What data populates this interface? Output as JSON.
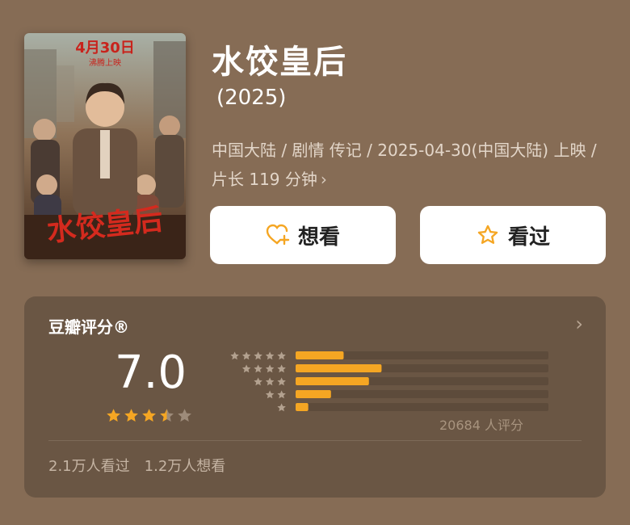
{
  "movie": {
    "title": "水饺皇后",
    "year": "(2025)",
    "meta": "中国大陆 / 剧情 传记 / 2025-04-30(中国大陆) 上映 / 片长 119 分钟",
    "poster": {
      "date": "4月30日",
      "tagline": "沸腾上映",
      "calligraphy": "水饺皇后"
    }
  },
  "actions": {
    "want_label": "想看",
    "seen_label": "看过"
  },
  "rating": {
    "header": "豆瓣评分®",
    "score": "7.0",
    "stars": 3.5,
    "count_text": "20684 人评分",
    "distribution": [
      0.19,
      0.34,
      0.29,
      0.14,
      0.05
    ]
  },
  "stats": {
    "seen": "2.1万人看过",
    "want": "1.2万人想看"
  },
  "colors": {
    "background": "#866c55",
    "card": "#6a5644",
    "accent": "#f5a623",
    "bar_track": "#5d4b3b"
  }
}
